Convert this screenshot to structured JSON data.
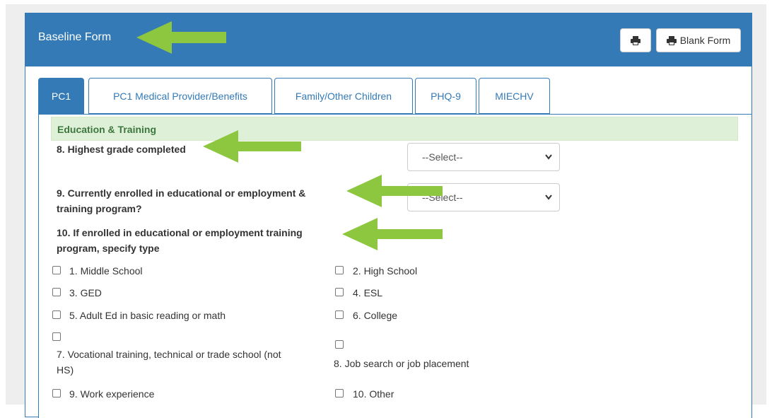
{
  "panel": {
    "title": "Baseline Form",
    "print_icon": "print-icon",
    "blank_form_label": "Blank Form"
  },
  "tabs": [
    {
      "label": "PC1",
      "active": true
    },
    {
      "label": "PC1 Medical Provider/Benefits",
      "active": false
    },
    {
      "label": "Family/Other Children",
      "active": false
    },
    {
      "label": "PHQ-9",
      "active": false
    },
    {
      "label": "MIECHV",
      "active": false
    }
  ],
  "section": {
    "title": "Education & Training"
  },
  "questions": {
    "q8": {
      "label": "8. Highest grade completed",
      "value": "--Select--"
    },
    "q9": {
      "line1": "9. Currently enrolled in educational or employment &",
      "line2": "training program?",
      "value": "--Select--"
    },
    "q10": {
      "line1": "10. If enrolled in educational or employment training",
      "line2": "program, specify type"
    }
  },
  "options": {
    "o1": "1. Middle School",
    "o2": "2. High School",
    "o3": "3. GED",
    "o4": "4. ESL",
    "o5": "5. Adult Ed in basic reading or math",
    "o6": "6. College",
    "o7_line1": "7. Vocational training, technical or trade school (not",
    "o7_line2": "HS)",
    "o8": "8. Job search or job placement",
    "o9": "9. Work experience",
    "o10": "10. Other"
  },
  "colors": {
    "primary": "#337ab7",
    "section_bg": "#dff0d8",
    "section_text": "#3c763d",
    "annotation_arrow": "#8dc63f"
  }
}
